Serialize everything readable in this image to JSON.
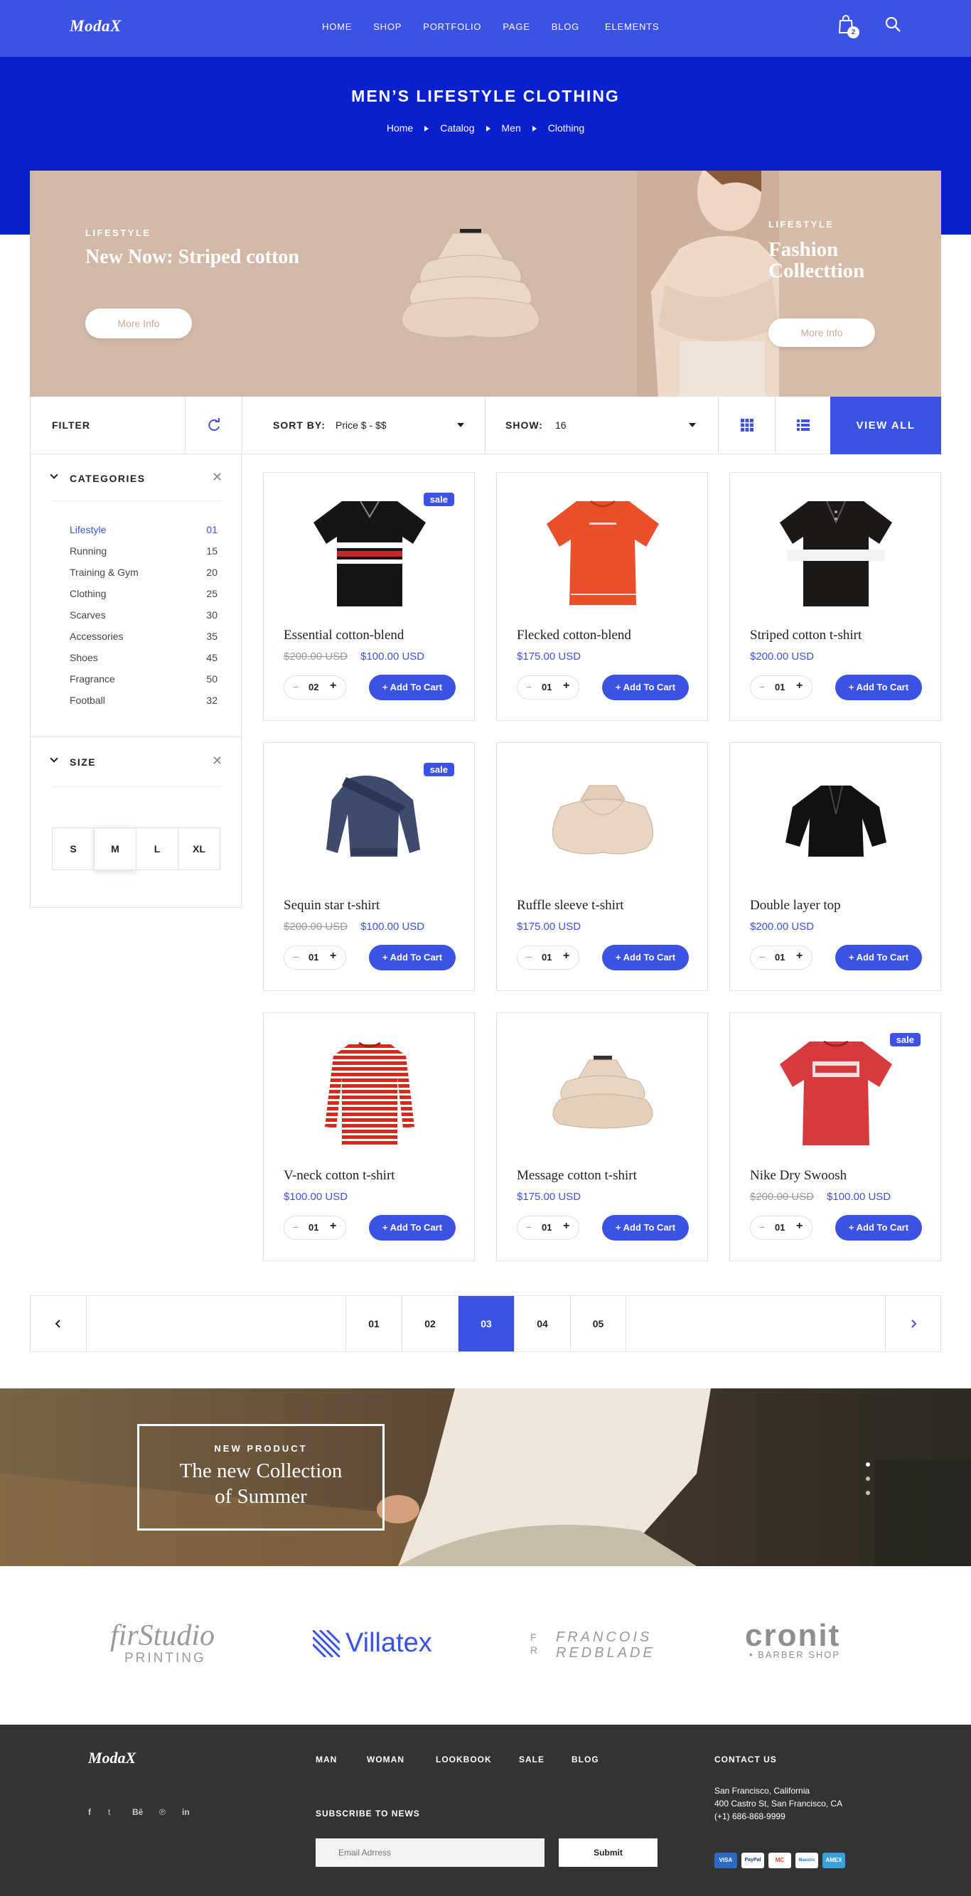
{
  "header": {
    "logo": "ModaX",
    "nav": [
      "HOME",
      "SHOP",
      "PORTFOLIO",
      "PAGE",
      "BLOG",
      "ELEMENTS"
    ],
    "cart_count": "2"
  },
  "hero": {
    "title": "MEN’S LIFESTYLE CLOTHING",
    "breadcrumb": [
      "Home",
      "Catalog",
      "Men",
      "Clothing"
    ]
  },
  "banners": {
    "left": {
      "kicker": "LIFESTYLE",
      "title": "New Now: Striped cotton",
      "button": "More Info"
    },
    "right": {
      "kicker": "LIFESTYLE",
      "title_line1": "Fashion",
      "title_line2": "Collecttion",
      "button": "More Info"
    }
  },
  "toolbar": {
    "filter_label": "FILTER",
    "sort_label": "SORT BY:",
    "sort_value": "Price $ - $$",
    "show_label": "SHOW:",
    "show_value": "16",
    "view_all": "VIEW ALL"
  },
  "sidebar": {
    "categories_title": "CATEGORIES",
    "categories": [
      {
        "name": "Lifestyle",
        "count": "01",
        "active": true
      },
      {
        "name": "Running",
        "count": "15"
      },
      {
        "name": "Training & Gym",
        "count": "20"
      },
      {
        "name": "Clothing",
        "count": "25"
      },
      {
        "name": "Scarves",
        "count": "30"
      },
      {
        "name": "Accessories",
        "count": "35"
      },
      {
        "name": "Shoes",
        "count": "45"
      },
      {
        "name": "Fragrance",
        "count": "50"
      },
      {
        "name": "Football",
        "count": "32"
      }
    ],
    "size_title": "SIZE",
    "sizes": [
      "S",
      "M",
      "L",
      "XL"
    ],
    "selected_size": "M"
  },
  "products": [
    {
      "name": "Essential cotton-blend",
      "old_price": "$200.00 USD",
      "price": "$100.00 USD",
      "sale": "sale",
      "qty": "02",
      "button": "+ Add To Cart",
      "image": "black-striped-polo"
    },
    {
      "name": "Flecked cotton-blend",
      "old_price": "",
      "price": "$175.00 USD",
      "sale": "",
      "qty": "01",
      "button": "+ Add To Cart",
      "image": "orange-tee"
    },
    {
      "name": "Striped cotton t-shirt",
      "old_price": "",
      "price": "$200.00 USD",
      "sale": "",
      "qty": "01",
      "button": "+ Add To Cart",
      "image": "black-white-stripe-polo"
    },
    {
      "name": "Sequin star t-shirt",
      "old_price": "$200.00 USD",
      "price": "$100.00 USD",
      "sale": "sale",
      "qty": "01",
      "button": "+ Add To Cart",
      "image": "navy-wrap-sweater"
    },
    {
      "name": "Ruffle sleeve t-shirt",
      "old_price": "",
      "price": "$175.00 USD",
      "sale": "",
      "qty": "01",
      "button": "+ Add To Cart",
      "image": "beige-ruffle-cape"
    },
    {
      "name": "Double layer top",
      "old_price": "",
      "price": "$200.00 USD",
      "sale": "",
      "qty": "01",
      "button": "+ Add To Cart",
      "image": "black-jacket"
    },
    {
      "name": "V-neck cotton t-shirt",
      "old_price": "",
      "price": "$100.00 USD",
      "sale": "",
      "qty": "01",
      "button": "+ Add To Cart",
      "image": "red-striped-longsleeve"
    },
    {
      "name": "Message cotton t-shirt",
      "old_price": "",
      "price": "$175.00 USD",
      "sale": "",
      "qty": "01",
      "button": "+ Add To Cart",
      "image": "beige-tiered-top"
    },
    {
      "name": "Nike Dry Swoosh",
      "old_price": "$200.00 USD",
      "price": "$100.00 USD",
      "sale": "sale",
      "qty": "01",
      "button": "+ Add To Cart",
      "image": "red-swoosh-tee"
    }
  ],
  "pagination": {
    "pages": [
      "01",
      "02",
      "03",
      "04",
      "05"
    ],
    "active": "03"
  },
  "promo": {
    "kicker": "NEW PRODUCT",
    "title_line1": "The new Collection",
    "title_line2": "of Summer"
  },
  "brands": {
    "b1_top": "firStudio",
    "b1_bottom": "PRINTING",
    "b2": "Villatex",
    "b3_mark_top": "F",
    "b3_mark_bottom": "R",
    "b3_top": "FRANCOIS",
    "b3_bottom": "REDBLADE",
    "b4_top": "cronit",
    "b4_bottom": "• BARBER SHOP"
  },
  "footer": {
    "logo": "ModaX",
    "links": [
      "MAN",
      "WOMAN",
      "LOOKBOOK",
      "SALE",
      "BLOG"
    ],
    "contact_title": "CONTACT US",
    "contact_lines": [
      "San Francisco, California",
      "400 Castro St, San Francisco, CA",
      "(+1) 686-868-9999"
    ],
    "social": [
      "f",
      "t",
      "Bē",
      "℗",
      "in"
    ],
    "subscribe_title": "SUBSCRIBE TO NEWS",
    "email_placeholder": "Email Adrress",
    "submit": "Submit",
    "payments": [
      "VISA",
      "PayPal",
      "MC",
      "Maestro",
      "AMEX"
    ]
  },
  "colors": {
    "accent": "#3b52e3",
    "hero": "#0a20cf",
    "footer": "#333333",
    "banner": "#d2b9a7"
  }
}
